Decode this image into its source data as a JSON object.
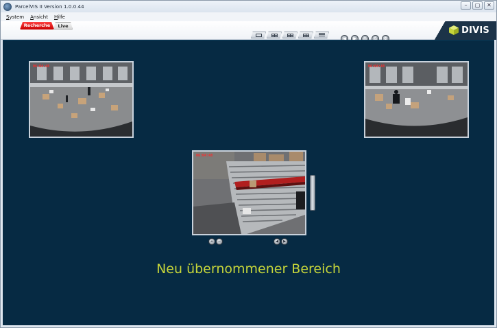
{
  "window": {
    "title": "ParcelVIS II Version 1.0.0.44",
    "controls": {
      "minimize": "–",
      "maximize": "▢",
      "close": "✕"
    }
  },
  "menu": {
    "items": [
      {
        "label_first": "S",
        "label_rest": "ystem"
      },
      {
        "label_first": "A",
        "label_rest": "nsicht"
      },
      {
        "label_first": "H",
        "label_rest": "ilfe"
      }
    ]
  },
  "tabs": [
    {
      "label": "Recherche",
      "active": true,
      "color": "#d60000"
    },
    {
      "label": "Live",
      "active": false
    }
  ],
  "layout_buttons": [
    {
      "icon": "single-view-icon"
    },
    {
      "icon": "grid-view-icon"
    },
    {
      "icon": "multi-view-icon"
    },
    {
      "icon": "split-view-icon"
    },
    {
      "icon": "list-view-icon"
    }
  ],
  "nav_buttons": [
    {
      "icon": "back-icon",
      "glyph": "◀"
    },
    {
      "icon": "forward-icon",
      "glyph": "▶"
    },
    {
      "icon": "target-icon",
      "glyph": "◎"
    },
    {
      "icon": "print-icon",
      "glyph": "⎙"
    },
    {
      "icon": "settings-icon",
      "glyph": "⚙"
    }
  ],
  "logo": {
    "text": "DIVIS",
    "band_color": "#1c3348",
    "cube_color": "#c6d53a"
  },
  "cameras": [
    {
      "id": "cam-1",
      "timestamp": "06:04:48"
    },
    {
      "id": "cam-2",
      "timestamp": "06:04:48"
    },
    {
      "id": "cam-3",
      "timestamp": "06:04:48"
    }
  ],
  "cam3_controls": {
    "left": [
      {
        "icon": "zoom-in-icon",
        "glyph": "+"
      },
      {
        "icon": "zoom-out-icon",
        "glyph": "−"
      }
    ],
    "right": [
      {
        "icon": "prev-icon",
        "glyph": "◀"
      },
      {
        "icon": "next-icon",
        "glyph": "▶"
      }
    ]
  },
  "caption": "Neu übernommener Bereich",
  "colors": {
    "background": "#062a43",
    "caption": "#c6d53a",
    "accent_red": "#d60000"
  }
}
